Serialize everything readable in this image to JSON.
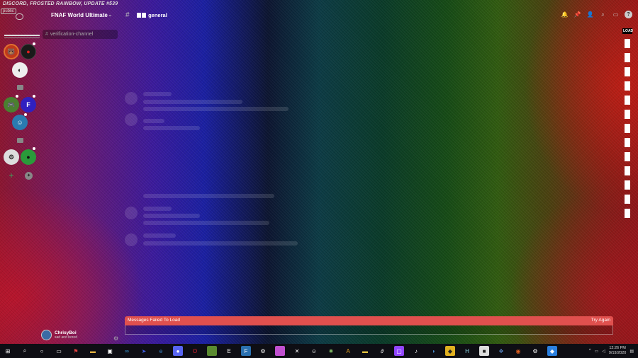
{
  "window": {
    "title": "DISCORD, FROSTED RAINBOW, UPDATE #539",
    "tag": "public"
  },
  "server": {
    "name": "FNAF World Ultimate",
    "chevron_icon": "chevron-down-icon"
  },
  "channel": {
    "name": "general",
    "hash_icon": "hash-icon"
  },
  "sidebar_channels": [
    {
      "name": "verification-channel"
    }
  ],
  "load_label": "LOAD",
  "error": {
    "message": "Messages Failed To Load",
    "action": "Try Again"
  },
  "user": {
    "name": "ChrisyBoi",
    "status": "sad and bored"
  },
  "clock": {
    "time": "12:26 PM",
    "date": "9/19/2020"
  },
  "colors": {
    "error": "#e0504e",
    "online": "#3ba55c",
    "taskbar": "#0e0e14"
  }
}
